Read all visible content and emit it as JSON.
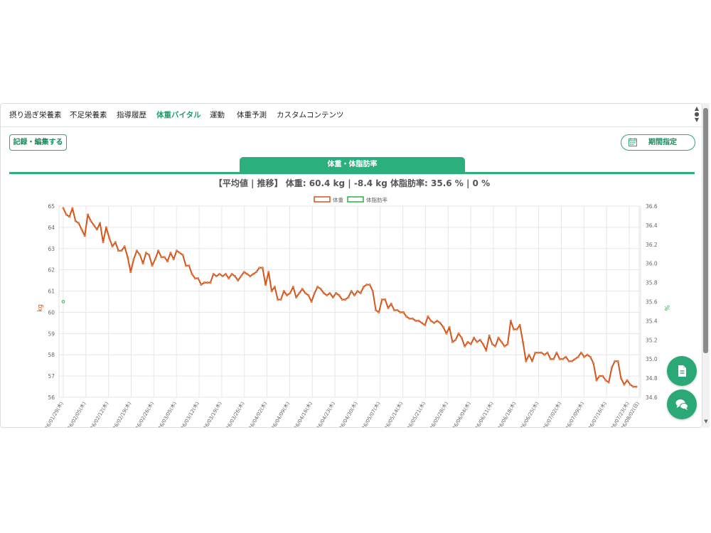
{
  "nav": {
    "tabs": [
      {
        "label": "摂り過ぎ栄養素",
        "active": false
      },
      {
        "label": "不足栄養素",
        "active": false
      },
      {
        "label": "指導履歴",
        "active": false
      },
      {
        "label": "体重バイタル",
        "active": true
      },
      {
        "label": "運動",
        "active": false
      },
      {
        "label": "体重予測",
        "active": false
      },
      {
        "label": "カスタムコンテンツ",
        "active": false
      }
    ]
  },
  "toolbar": {
    "record_label": "記録・編集する",
    "period_label": "期間指定"
  },
  "chart_tab": {
    "label": "体重・体脂肪率"
  },
  "summary": "【平均値 | 推移】 体重: 60.4 kg | -8.4 kg 体脂肪率: 35.6 % | 0 %",
  "colors": {
    "accent": "#2bb07d",
    "weight_series": "#d4541a",
    "bodyfat_series": "#2ab04a"
  },
  "icons": {
    "calendar": "calendar-icon",
    "document": "document-icon",
    "chat": "chat-icon"
  },
  "chart_data": {
    "type": "line",
    "legend": [
      "体重",
      "体脂肪率"
    ],
    "legend_position": "top",
    "ylabel_left": "kg",
    "ylabel_right": "%",
    "ylim_left": [
      56,
      65
    ],
    "yticks_left": [
      "56",
      "57",
      "58",
      "59",
      "60",
      "61",
      "62",
      "63",
      "64",
      "65"
    ],
    "ylim_right": [
      34.6,
      36.6
    ],
    "yticks_right": [
      "34.6",
      "34.8",
      "35.0",
      "35.2",
      "35.4",
      "35.6",
      "35.8",
      "36.0",
      "36.2",
      "36.4",
      "36.6"
    ],
    "grid": true,
    "x_start": "2026-01-29",
    "x_end": "2026-08-02",
    "xtick_labels": [
      "2026/01/29(木)",
      "2026/02/05(木)",
      "2026/02/12(木)",
      "2026/02/19(木)",
      "2026/02/26(木)",
      "2026/03/05(木)",
      "2026/03/12(木)",
      "2026/03/19(木)",
      "2026/03/26(木)",
      "2026/04/02(木)",
      "2026/04/09(木)",
      "2026/04/16(木)",
      "2026/04/23(木)",
      "2026/04/30(木)",
      "2026/05/07(木)",
      "2026/05/14(木)",
      "2026/05/21(木)",
      "2026/05/28(木)",
      "2026/06/04(木)",
      "2026/06/11(木)",
      "2026/06/18(木)",
      "2026/06/25(木)",
      "2026/07/02(木)",
      "2026/07/09(木)",
      "2026/07/16(木)",
      "2026/07/23(木)",
      "2026/08/02(日)"
    ],
    "series": [
      {
        "name": "体重",
        "y_axis": "left",
        "values": [
          64.9,
          64.6,
          64.5,
          64.9,
          64.3,
          64.2,
          63.9,
          63.6,
          64.6,
          64.3,
          64.1,
          63.9,
          64.2,
          63.3,
          64.0,
          63.5,
          63.1,
          63.3,
          62.9,
          62.9,
          63.1,
          62.6,
          61.9,
          62.5,
          62.9,
          62.7,
          62.3,
          62.8,
          62.7,
          62.2,
          62.5,
          62.9,
          62.6,
          62.6,
          62.4,
          62.8,
          62.5,
          62.9,
          62.8,
          62.7,
          62.2,
          62.2,
          61.8,
          61.6,
          61.6,
          61.3,
          61.4,
          61.4,
          61.4,
          61.8,
          61.7,
          61.8,
          61.7,
          61.8,
          61.6,
          61.8,
          61.7,
          61.5,
          61.7,
          61.9,
          61.8,
          61.7,
          61.8,
          61.9,
          62.1,
          62.1,
          61.3,
          61.9,
          61.0,
          61.2,
          60.6,
          60.6,
          61.0,
          60.8,
          60.9,
          61.2,
          60.7,
          60.9,
          61.1,
          60.9,
          60.8,
          60.5,
          60.9,
          61.2,
          61.1,
          60.9,
          60.8,
          60.9,
          60.7,
          60.9,
          60.8,
          60.6,
          60.6,
          60.7,
          61.0,
          60.8,
          61.0,
          60.9,
          61.2,
          61.3,
          61.3,
          61.0,
          60.1,
          60.0,
          60.6,
          60.6,
          60.2,
          60.4,
          60.1,
          60.1,
          60.0,
          60.0,
          59.8,
          59.7,
          59.7,
          59.6,
          59.6,
          59.5,
          59.4,
          59.8,
          59.6,
          59.5,
          59.6,
          59.5,
          59.3,
          59.0,
          59.3,
          58.6,
          58.7,
          59.0,
          58.8,
          58.4,
          58.6,
          58.5,
          58.8,
          58.6,
          58.7,
          58.5,
          58.2,
          58.9,
          58.5,
          58.4,
          58.8,
          58.6,
          58.4,
          58.5,
          59.6,
          59.2,
          59.2,
          59.4,
          58.6,
          57.7,
          58.0,
          57.7,
          58.1,
          58.1,
          58.1,
          58.0,
          58.1,
          57.8,
          57.8,
          58.1,
          57.8,
          57.8,
          57.9,
          57.7,
          57.7,
          57.8,
          57.9,
          58.1,
          57.9,
          58.0,
          57.9,
          57.6,
          56.8,
          57.0,
          57.0,
          56.8,
          56.7,
          57.4,
          57.7,
          57.7,
          56.9,
          56.6,
          56.8,
          56.6,
          56.5,
          56.5
        ]
      },
      {
        "name": "体脂肪率",
        "y_axis": "right",
        "values": [
          35.6
        ]
      }
    ]
  }
}
